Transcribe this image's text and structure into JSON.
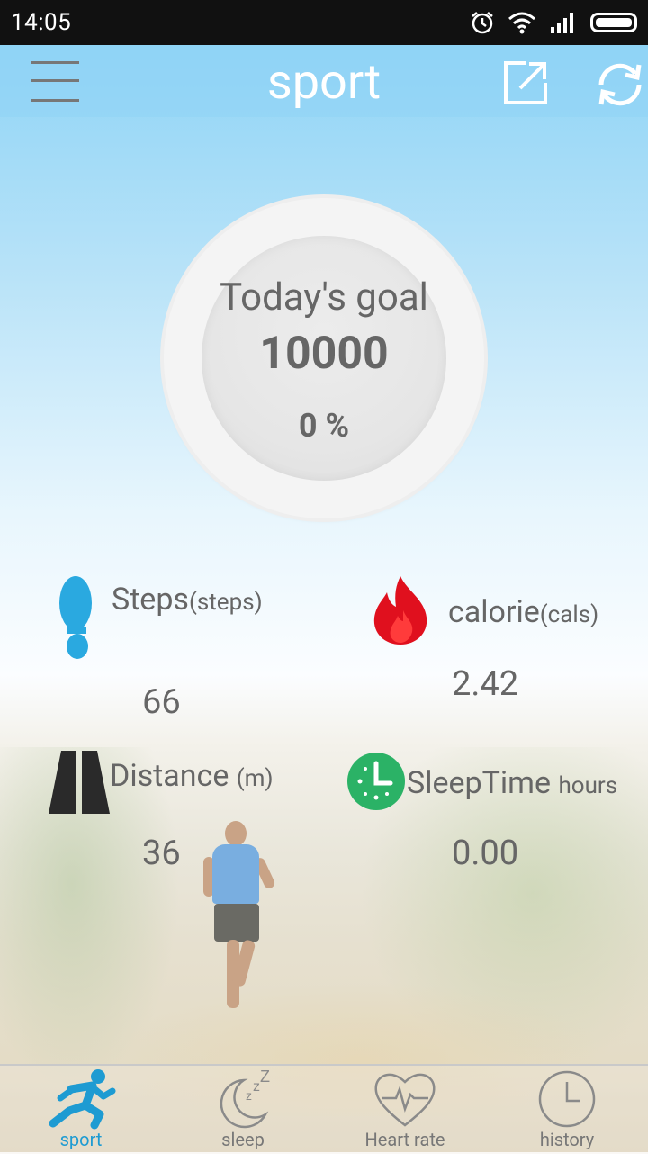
{
  "status_bar": {
    "time": "14:05"
  },
  "header": {
    "title": "sport"
  },
  "goal": {
    "label": "Today's goal",
    "value": "10000",
    "percent": "0 %"
  },
  "stats": {
    "steps": {
      "label": "Steps",
      "unit": "(steps)",
      "value": "66"
    },
    "calorie": {
      "label": "calorie",
      "unit": "(cals)",
      "value": "2.42"
    },
    "distance": {
      "label": "Distance ",
      "unit": "(m)",
      "value": "36"
    },
    "sleep_time": {
      "label": "SleepTime ",
      "unit": "hours",
      "value": "0.00"
    }
  },
  "bottom_nav": {
    "items": [
      {
        "label": "sport",
        "icon": "runner-icon",
        "active": true
      },
      {
        "label": "sleep",
        "icon": "moon-icon",
        "active": false
      },
      {
        "label": "Heart rate",
        "icon": "heart-icon",
        "active": false
      },
      {
        "label": "history",
        "icon": "clock-icon",
        "active": false
      }
    ]
  },
  "colors": {
    "accent": "#1e9bd2",
    "sky": "#8fd4f6",
    "flame": "#e0101e",
    "clock": "#2bb266",
    "text": "#666666"
  }
}
